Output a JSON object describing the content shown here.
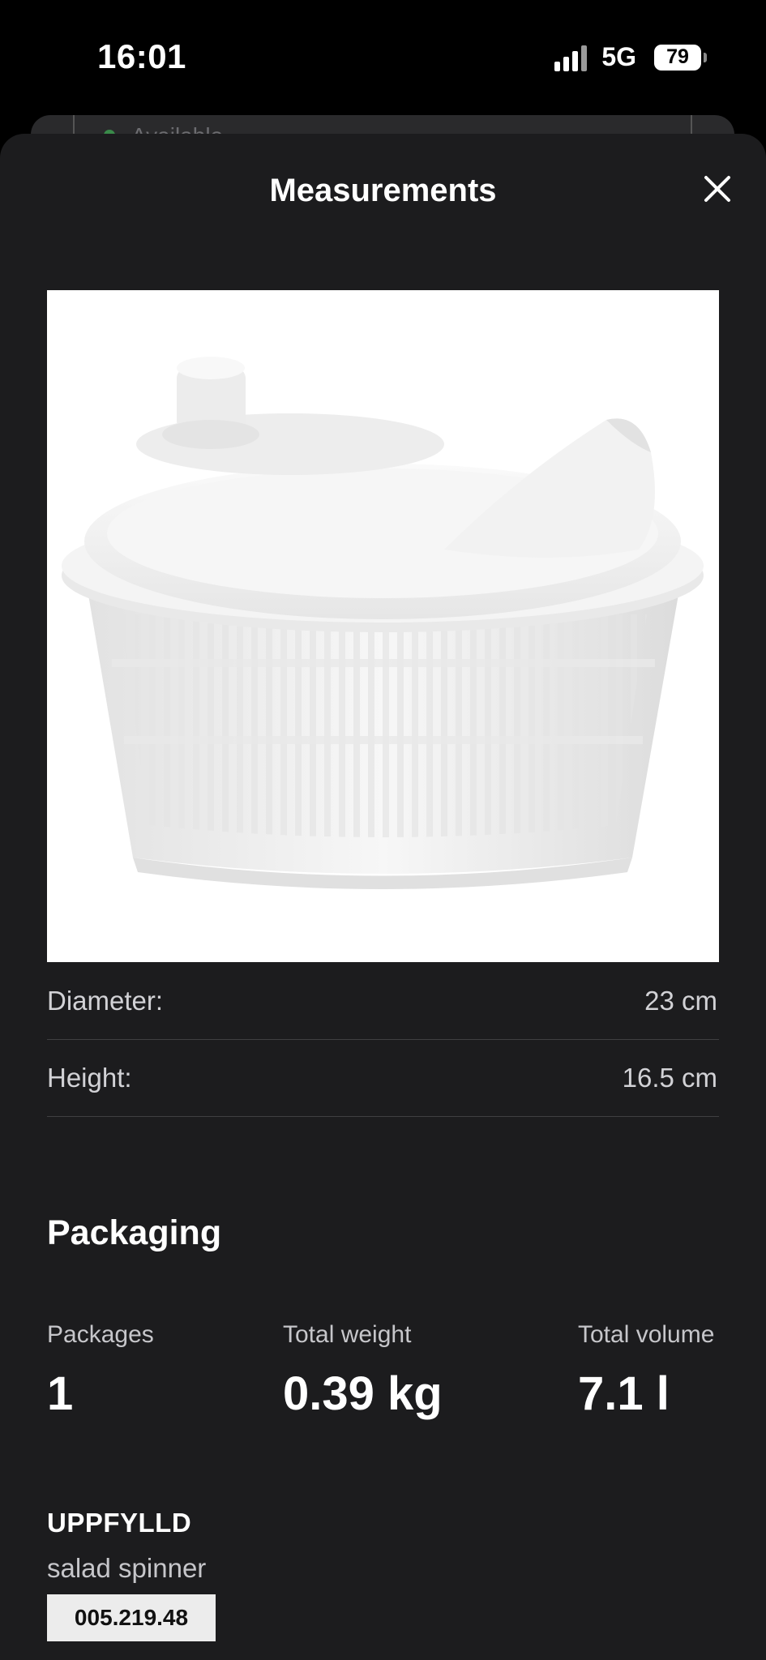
{
  "status_bar": {
    "time": "16:01",
    "network": "5G",
    "battery": "79"
  },
  "background_page": {
    "availability_text": "Available",
    "availability_color": "#3a8a4a"
  },
  "sheet": {
    "title": "Measurements",
    "close_icon": "close-icon",
    "image_alt": "salad spinner product photo"
  },
  "measurements": [
    {
      "label": "Diameter:",
      "value": "23 cm"
    },
    {
      "label": "Height:",
      "value": "16.5 cm"
    }
  ],
  "packaging": {
    "title": "Packaging",
    "columns": [
      {
        "label": "Packages",
        "value": "1"
      },
      {
        "label": "Total weight",
        "value": "0.39 kg"
      },
      {
        "label": "Total volume",
        "value": "7.1 l"
      }
    ]
  },
  "product": {
    "name": "UPPFYLLD",
    "description": "salad spinner",
    "article_number": "005.219.48"
  },
  "colors": {
    "sheet_background": "#1c1c1e",
    "page_background": "#000000",
    "divider": "#3f3f42",
    "text_primary": "#ffffff",
    "text_secondary": "#c6c6ca",
    "article_badge": "#ececec"
  }
}
